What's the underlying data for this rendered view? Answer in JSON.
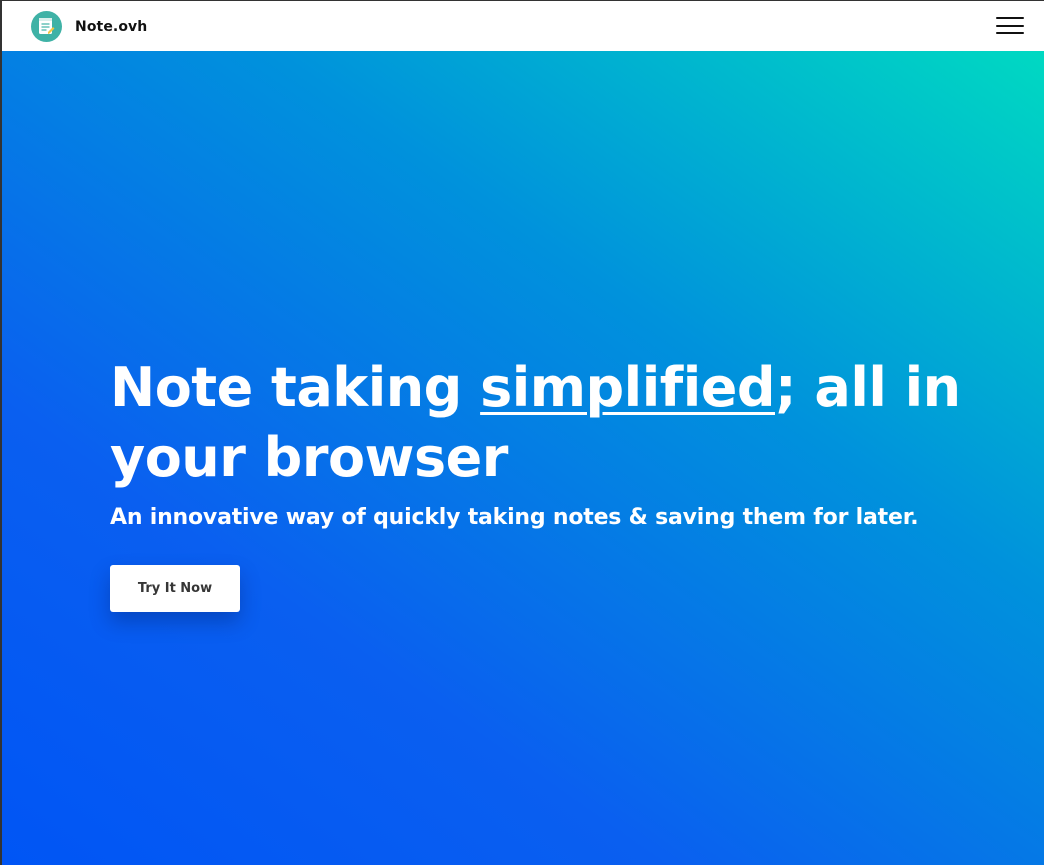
{
  "navbar": {
    "brand": "Note.ovh",
    "logo_icon": "notepad-icon",
    "menu_icon": "hamburger-menu-icon"
  },
  "hero": {
    "headline_before": "Note taking ",
    "headline_emphasis": "simplified",
    "headline_after": "; all in your browser",
    "subheadline": "An innovative way of quickly taking notes & saving them for later.",
    "cta_label": "Try It Now"
  },
  "colors": {
    "gradient_start": "#0055f5",
    "gradient_mid": "#0092dc",
    "gradient_end": "#00d9c2",
    "logo_bg": "#3fb2a6"
  }
}
